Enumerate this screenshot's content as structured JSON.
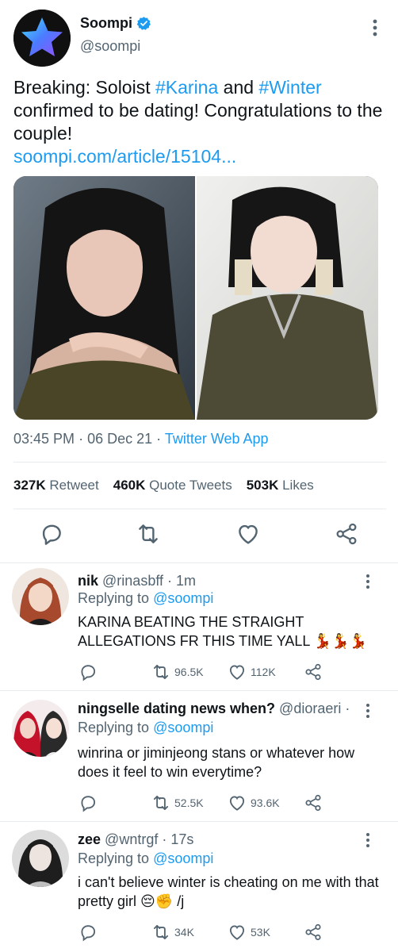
{
  "main_tweet": {
    "author_name": "Soompi",
    "author_handle": "@soompi",
    "text_part1": "Breaking: Soloist ",
    "hashtag1": "#Karina",
    "text_part2": " and ",
    "hashtag2": "#Winter",
    "text_part3": " confirmed to be dating! Congratulations to the couple!",
    "link": "soompi.com/article/15104...",
    "time": "03:45 PM",
    "date": "06 Dec 21",
    "source": "Twitter Web App",
    "stats": {
      "retweets_count": "327K",
      "retweets_label": "Retweet",
      "quotes_count": "460K",
      "quotes_label": "Quote Tweets",
      "likes_count": "503K",
      "likes_label": "Likes"
    }
  },
  "replies": [
    {
      "name": "nik",
      "handle": "@rinasbff",
      "time": "1m",
      "replying_label": "Replying to",
      "replying_to": "@soompi",
      "text": "KARINA BEATING THE STRAIGHT ALLEGATIONS FR THIS TIME YALL 💃💃💃",
      "retweets": "96.5K",
      "likes": "112K"
    },
    {
      "name": "ningselle dating news when?",
      "handle": "@dioraeri",
      "time": "...",
      "replying_label": "Replying to",
      "replying_to": "@soompi",
      "text": "winrina or jiminjeong stans or whatever how does it feel to win everytime?",
      "retweets": "52.5K",
      "likes": "93.6K"
    },
    {
      "name": "zee",
      "handle": "@wntrgf",
      "time": "17s",
      "replying_label": "Replying to",
      "replying_to": "@soompi",
      "text": "i can't believe winter is cheating on me with that pretty girl 😔✊ /j",
      "retweets": "34K",
      "likes": "53K"
    }
  ],
  "colors": {
    "accent": "#1d9bf0",
    "text": "#0f1419",
    "muted": "#536471",
    "divider": "#e6ecf0"
  },
  "icons": [
    "verified-badge-icon",
    "more-icon",
    "reply-icon",
    "retweet-icon",
    "like-icon",
    "share-icon"
  ]
}
